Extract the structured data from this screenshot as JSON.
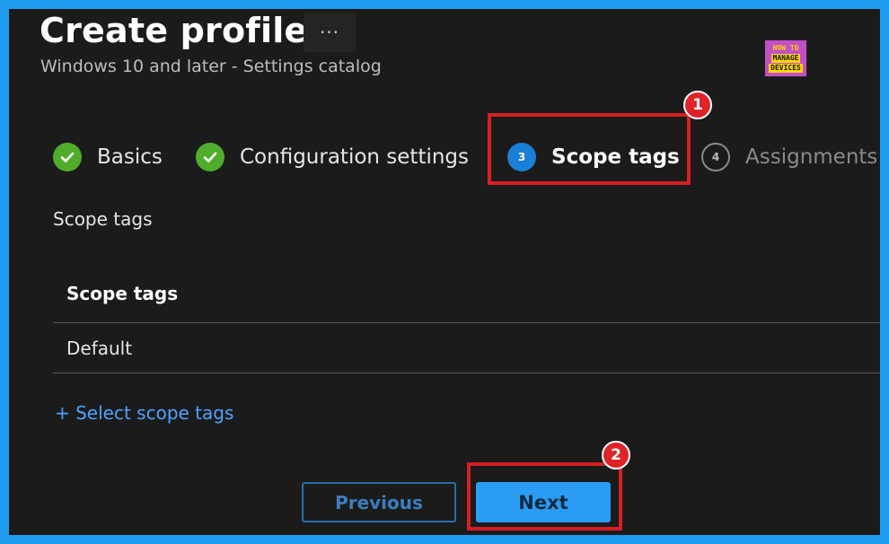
{
  "header": {
    "title": "Create profile",
    "more_label": "···",
    "subtitle": "Windows 10 and later - Settings catalog"
  },
  "logo": {
    "line1": "HOW TO",
    "line2": "MANAGE",
    "line3": "DEVICES"
  },
  "steps": [
    {
      "number": "",
      "label": "Basics",
      "state": "complete",
      "icon": "checkmark-icon"
    },
    {
      "number": "",
      "label": "Configuration settings",
      "state": "complete",
      "icon": "checkmark-icon"
    },
    {
      "number": "3",
      "label": "Scope tags",
      "state": "active",
      "icon": "step-number-icon"
    },
    {
      "number": "4",
      "label": "Assignments",
      "state": "inactive",
      "icon": "step-number-icon"
    }
  ],
  "annotations": {
    "badge1": "1",
    "badge2": "2",
    "color": "#d71f26"
  },
  "content": {
    "section_label": "Scope tags",
    "table_header": "Scope tags",
    "rows": [
      "Default"
    ],
    "select_link": "+ Select scope tags"
  },
  "footer": {
    "previous_label": "Previous",
    "next_label": "Next"
  },
  "colors": {
    "accent": "#2a9cf3",
    "success": "#4fad2b",
    "background": "#1b1b1b",
    "frame": "#1e9cf0"
  }
}
